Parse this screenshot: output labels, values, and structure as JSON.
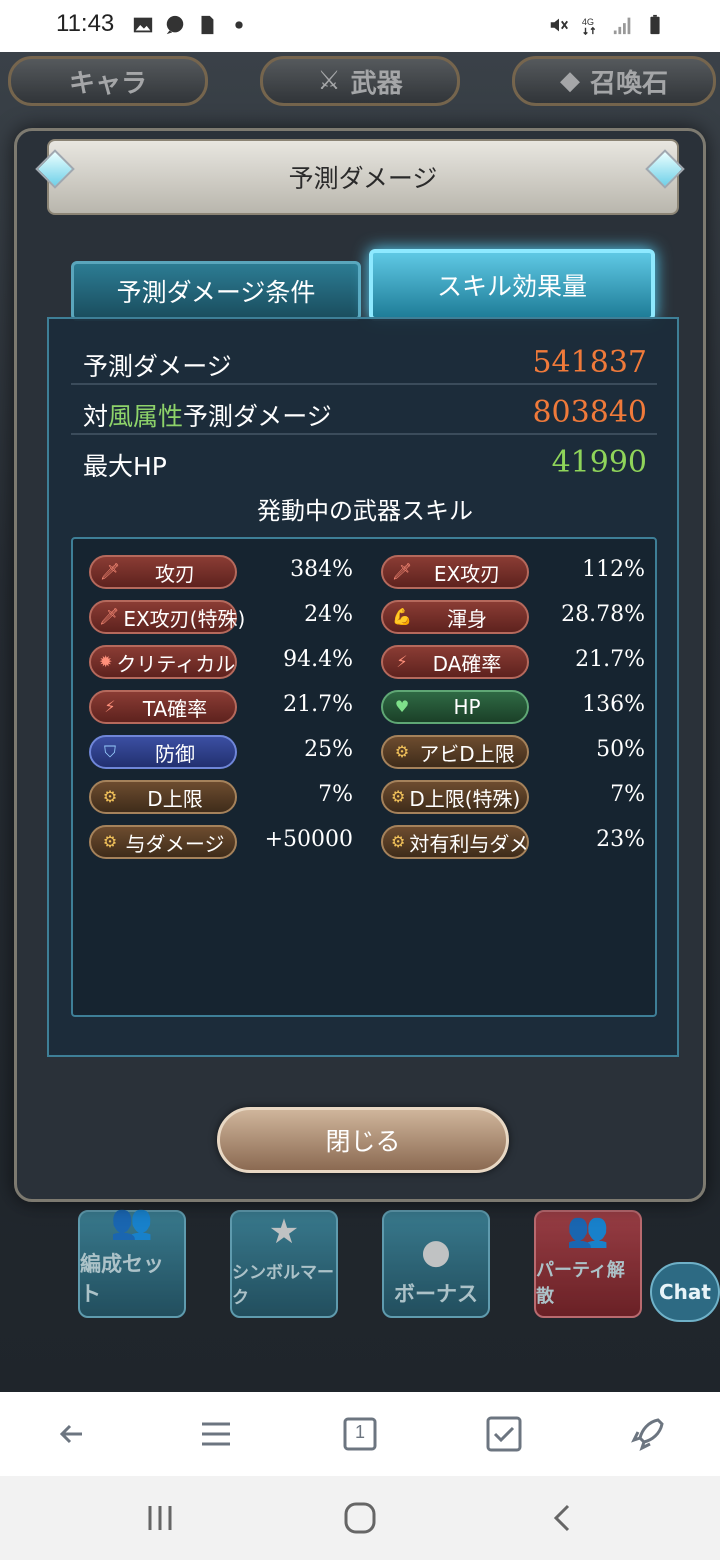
{
  "status_bar": {
    "time": "11:43"
  },
  "game_tabs": {
    "chara": "キャラ",
    "weapon": "武器",
    "summon": "召喚石"
  },
  "bottom_buttons": [
    {
      "label": "編成セット"
    },
    {
      "label": "シンボルマーク"
    },
    {
      "label": "ボーナス"
    },
    {
      "label": "パーティ解散"
    }
  ],
  "chat_label": "Chat",
  "dialog": {
    "title": "予測ダメージ",
    "tab_conditions": "予測ダメージ条件",
    "tab_skill_amount": "スキル効果量",
    "rows": [
      {
        "label": "予測ダメージ",
        "value": "541837"
      },
      {
        "label_pre": "対",
        "label_wind": "風属性",
        "label_post": "予測ダメージ",
        "value": "803840"
      },
      {
        "label": "最大HP",
        "value": "41990"
      }
    ],
    "skills_heading": "発動中の武器スキル",
    "skills": [
      {
        "name": "攻刃",
        "value": "384%",
        "style": "red",
        "icon": "sword-icon"
      },
      {
        "name": "EX攻刃",
        "value": "112%",
        "style": "red",
        "icon": "sword-icon"
      },
      {
        "name": "EX攻刃(特殊)",
        "value": "24%",
        "style": "red",
        "icon": "sword-icon"
      },
      {
        "name": "渾身",
        "value": "28.78%",
        "style": "red",
        "icon": "muscle-icon"
      },
      {
        "name": "クリティカル",
        "value": "94.4%",
        "style": "red",
        "icon": "critical-icon"
      },
      {
        "name": "DA確率",
        "value": "21.7%",
        "style": "red",
        "icon": "double-attack-icon"
      },
      {
        "name": "TA確率",
        "value": "21.7%",
        "style": "red",
        "icon": "triple-attack-icon"
      },
      {
        "name": "HP",
        "value": "136%",
        "style": "green",
        "icon": "heart-icon"
      },
      {
        "name": "防御",
        "value": "25%",
        "style": "blue",
        "icon": "shield-icon"
      },
      {
        "name": "アビD上限",
        "value": "50%",
        "style": "brown",
        "icon": "gear-icon"
      },
      {
        "name": "D上限",
        "value": "7%",
        "style": "brown",
        "icon": "gear-icon"
      },
      {
        "name": "D上限(特殊)",
        "value": "7%",
        "style": "brown",
        "icon": "gear-icon"
      },
      {
        "name": "与ダメージ",
        "value": "+50000",
        "style": "brown",
        "icon": "gear-icon"
      },
      {
        "name": "対有利与ダメ",
        "value": "23%",
        "style": "brown",
        "icon": "gear-icon"
      }
    ],
    "close_label": "閉じる"
  },
  "browser_nav": {
    "tab_count": "1"
  },
  "colors": {
    "damage": "#f07a3a",
    "hp": "#8fd45a",
    "wind": "#8ed36a",
    "accent": "#58d7ff"
  }
}
